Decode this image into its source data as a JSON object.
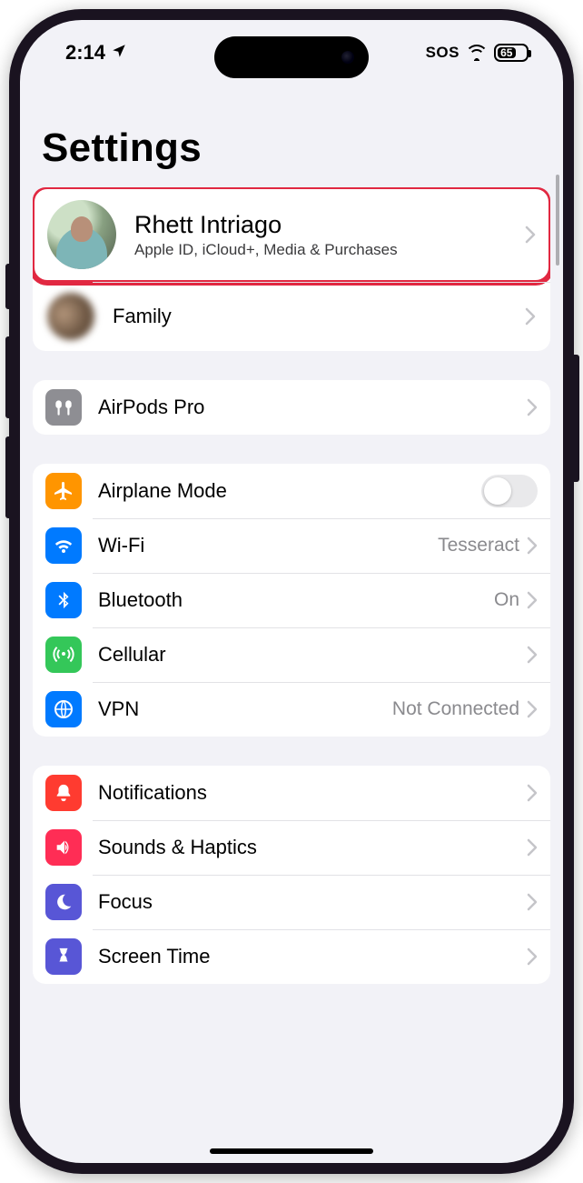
{
  "status": {
    "time": "2:14",
    "location_active": true,
    "sos": "SOS",
    "battery_pct": "65"
  },
  "page": {
    "title": "Settings"
  },
  "profile": {
    "name": "Rhett Intriago",
    "subtitle": "Apple ID, iCloud+, Media & Purchases"
  },
  "family": {
    "label": "Family"
  },
  "airpods": {
    "label": "AirPods Pro"
  },
  "connectivity": {
    "airplane": {
      "label": "Airplane Mode",
      "on": false
    },
    "wifi": {
      "label": "Wi-Fi",
      "value": "Tesseract"
    },
    "bluetooth": {
      "label": "Bluetooth",
      "value": "On"
    },
    "cellular": {
      "label": "Cellular"
    },
    "vpn": {
      "label": "VPN",
      "value": "Not Connected"
    }
  },
  "system": {
    "notifications": {
      "label": "Notifications"
    },
    "sounds": {
      "label": "Sounds & Haptics"
    },
    "focus": {
      "label": "Focus"
    },
    "screentime": {
      "label": "Screen Time"
    }
  },
  "highlight_color": "#e12841"
}
